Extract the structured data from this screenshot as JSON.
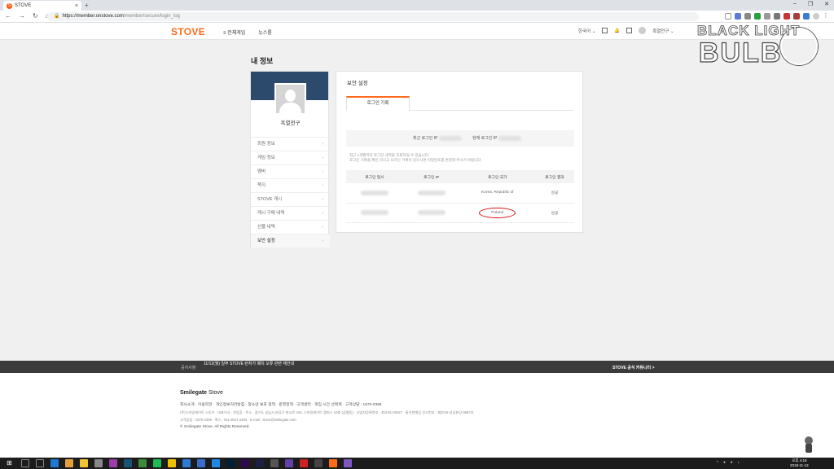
{
  "browser": {
    "tab_title": "STOVE",
    "tab_favicon": "S",
    "url_host": "https://member.onstove.com",
    "url_path": "/member/secure/login_log"
  },
  "header": {
    "logo": "STOVE",
    "nav": [
      "≡ 전체게임",
      "뉴스룸"
    ],
    "lang": "한국어",
    "username": "흑열전구"
  },
  "watermark": {
    "line1": "BLACK LIGHT",
    "line2": "BULB"
  },
  "page": {
    "title": "내 정보"
  },
  "sidebar": {
    "name": "흑열전구",
    "items": [
      {
        "label": "회원 정보"
      },
      {
        "label": "게임 정보"
      },
      {
        "label": "멤버"
      },
      {
        "label": "쪽지"
      },
      {
        "label": "STOVE 캐시"
      },
      {
        "label": "캐시 구매 내역"
      },
      {
        "label": "선물 내역"
      },
      {
        "label": "보안 설정"
      }
    ]
  },
  "main": {
    "title": "보안 설정",
    "tab": "로그인 기록",
    "recent_login_ip": "최근 로그인 IP",
    "current_login_ip": "현재 로그인 IP",
    "note1": "최근 1개월까지 로그인 내역을 조회하실 수 있습니다.",
    "note2": "로그인 기록을 확인 하시고 모르는 기록이 있으시면 비밀번호를 변경해 주시기 바랍니다.",
    "table": {
      "headers": [
        "로그인 일시",
        "로그인 IP",
        "로그인 국가",
        "로그인 결과"
      ],
      "rows": [
        {
          "country": "Korea, Republic of",
          "result": "성공"
        },
        {
          "country": "Poland",
          "result": "성공"
        }
      ]
    }
  },
  "footer": {
    "notice_label": "공지사항",
    "notice_msg": "11/12(월) 일부 STOVE 런처가 패치 오류 관련 재안내",
    "community": "STOVE 공식 커뮤니티 >",
    "brand_bold": "Smilegate",
    "brand_rest": " Stove",
    "links": "회사소개 · 이용약관 · 개인정보처리방침 · 청소년 보호 정책 · 운영정책 · 고객센터 · 게임 시간 선택제 · 고객상담 : 1670-0399",
    "info1": "(주)스마일게이트 스토브 · 대표이사 : 한동훈 · 주소 : 경기도 성남시 분당구 판교로 344, 스마일게이트 캠퍼스 10층 (삼평동) · 사업자등록번호 : 403-81-00027 · 통신판매업 신고번호 : 제2016-성남분당-0687호",
    "info2": "고객상담 : 1670-0399 · 팩스 : 031-8017-4400 · E-mail : stove@smilegate.com",
    "copyright": "© Smilegate Stove. All Rights Reserved."
  },
  "taskbar": {
    "tray": "^",
    "time": "오후 4:18",
    "date": "2018-11-12"
  },
  "colors": {
    "brand": "#ff6b1a",
    "banner": "#2c4a6b",
    "highlight_circle": "#d10e0e"
  }
}
